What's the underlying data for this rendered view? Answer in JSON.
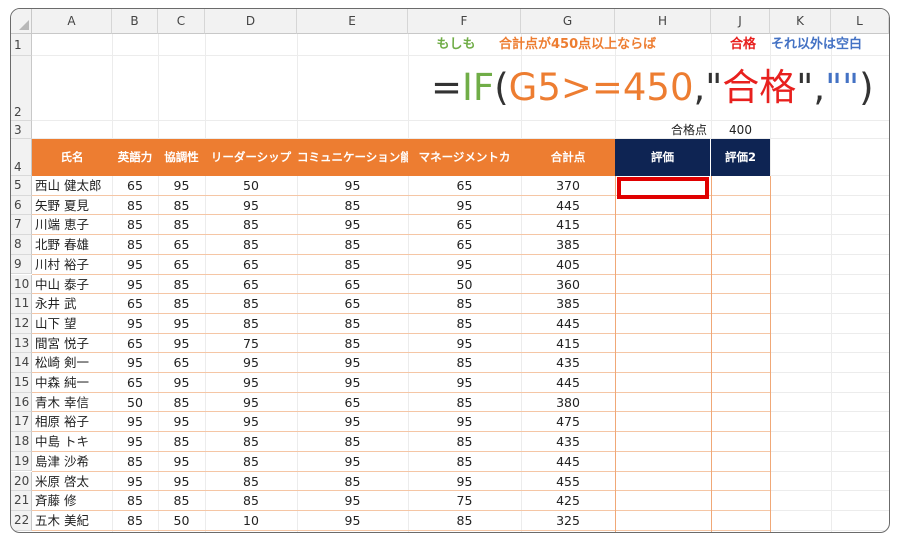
{
  "columns": [
    "A",
    "B",
    "C",
    "D",
    "E",
    "F",
    "G",
    "H",
    "J",
    "K",
    "L"
  ],
  "row_numbers": [
    "1",
    "2",
    "3",
    "4",
    "5",
    "6",
    "7",
    "8",
    "9",
    "10",
    "11",
    "12",
    "13",
    "14",
    "15",
    "16",
    "17",
    "18",
    "19",
    "20",
    "21",
    "22"
  ],
  "annotations": {
    "if_label": "もしも",
    "condition_label": "合計点が450点以上ならば",
    "pass_label": "合格",
    "else_label": "それ以外は空白"
  },
  "formula": {
    "eq": "=",
    "func": "IF",
    "paren_open": "(",
    "cond": "G5>=450",
    "comma1": ",",
    "quote_open": "\"",
    "pass": "合格",
    "quote_close": "\"",
    "comma2": ",",
    "empty": "\"\"",
    "paren_close": ")"
  },
  "threshold": {
    "label": "合格点",
    "value": "400"
  },
  "headers": {
    "name": "氏名",
    "english": "英語力",
    "cooperation": "協調性",
    "leadership": "リーダーシップ",
    "communication": "コミュニケーション能力",
    "management": "マネージメントカ",
    "total": "合計点",
    "eval": "評価",
    "eval2": "評価2"
  },
  "rows": [
    {
      "name": "西山 健太郎",
      "b": "65",
      "c": "95",
      "d": "50",
      "e": "95",
      "f": "65",
      "g": "370"
    },
    {
      "name": "矢野 夏見",
      "b": "85",
      "c": "85",
      "d": "95",
      "e": "85",
      "f": "95",
      "g": "445"
    },
    {
      "name": "川端 恵子",
      "b": "85",
      "c": "85",
      "d": "85",
      "e": "95",
      "f": "65",
      "g": "415"
    },
    {
      "name": "北野 春雄",
      "b": "85",
      "c": "65",
      "d": "85",
      "e": "85",
      "f": "65",
      "g": "385"
    },
    {
      "name": "川村 裕子",
      "b": "95",
      "c": "65",
      "d": "65",
      "e": "85",
      "f": "95",
      "g": "405"
    },
    {
      "name": "中山 泰子",
      "b": "95",
      "c": "85",
      "d": "65",
      "e": "65",
      "f": "50",
      "g": "360"
    },
    {
      "name": "永井 武",
      "b": "65",
      "c": "85",
      "d": "85",
      "e": "65",
      "f": "85",
      "g": "385"
    },
    {
      "name": "山下 望",
      "b": "95",
      "c": "95",
      "d": "85",
      "e": "85",
      "f": "85",
      "g": "445"
    },
    {
      "name": "間宮 悦子",
      "b": "65",
      "c": "95",
      "d": "75",
      "e": "85",
      "f": "95",
      "g": "415"
    },
    {
      "name": "松崎 剣一",
      "b": "95",
      "c": "65",
      "d": "95",
      "e": "95",
      "f": "85",
      "g": "435"
    },
    {
      "name": "中森 純一",
      "b": "65",
      "c": "95",
      "d": "95",
      "e": "95",
      "f": "95",
      "g": "445"
    },
    {
      "name": "青木 幸信",
      "b": "50",
      "c": "85",
      "d": "95",
      "e": "65",
      "f": "85",
      "g": "380"
    },
    {
      "name": "相原 裕子",
      "b": "95",
      "c": "95",
      "d": "95",
      "e": "95",
      "f": "95",
      "g": "475"
    },
    {
      "name": "中島 トキ",
      "b": "95",
      "c": "85",
      "d": "85",
      "e": "85",
      "f": "85",
      "g": "435"
    },
    {
      "name": "島津 沙希",
      "b": "85",
      "c": "95",
      "d": "85",
      "e": "95",
      "f": "85",
      "g": "445"
    },
    {
      "name": "米原 啓太",
      "b": "95",
      "c": "95",
      "d": "85",
      "e": "85",
      "f": "95",
      "g": "455"
    },
    {
      "name": "斉藤 修",
      "b": "85",
      "c": "85",
      "d": "85",
      "e": "95",
      "f": "75",
      "g": "425"
    },
    {
      "name": "五木 美紀",
      "b": "85",
      "c": "50",
      "d": "10",
      "e": "95",
      "f": "85",
      "g": "325"
    }
  ],
  "colors": {
    "orange": "#ed7d31",
    "navy": "#0e2453",
    "green": "#70ad47",
    "red": "#e8201e",
    "blue": "#4472c4",
    "selection": "#e00000"
  }
}
